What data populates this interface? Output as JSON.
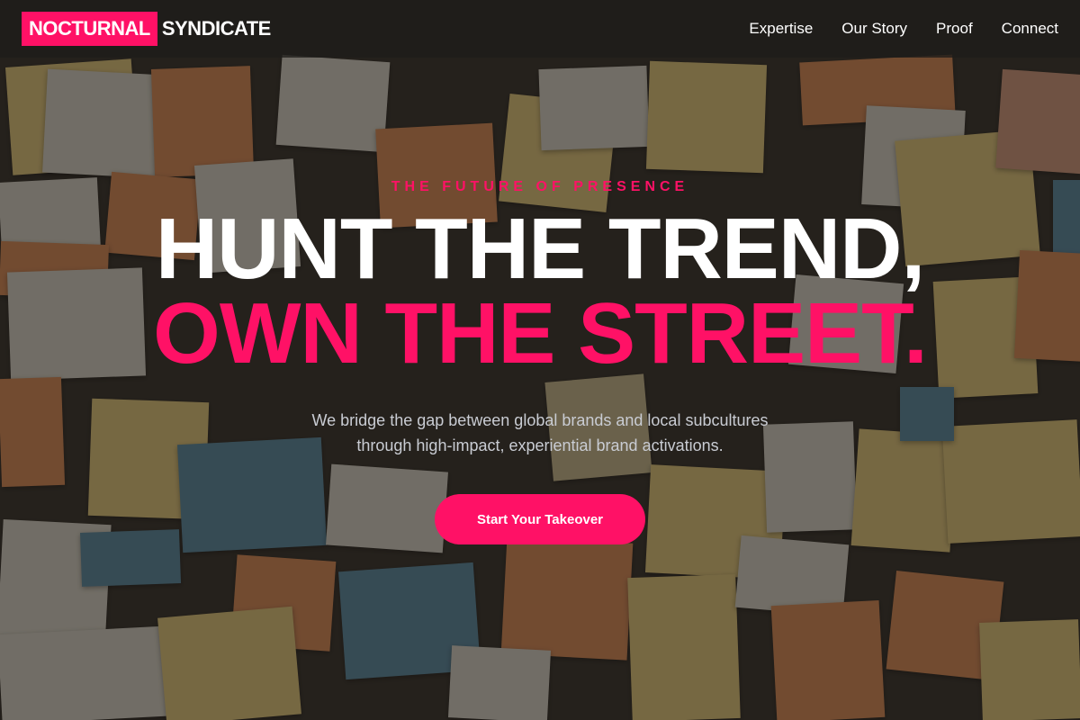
{
  "brand": {
    "name_highlight": "NOCTURNAL",
    "name_rest": "SYNDICATE",
    "accent_color": "#ff1166"
  },
  "nav": {
    "items": [
      {
        "label": "Expertise"
      },
      {
        "label": "Our Story"
      },
      {
        "label": "Proof"
      },
      {
        "label": "Connect"
      }
    ]
  },
  "hero": {
    "eyebrow": "THE FUTURE OF PRESENCE",
    "headline_line1": "HUNT THE TREND,",
    "headline_line2": "OWN THE STREET.",
    "subtitle_line1": "We bridge the gap between global brands and local subcultures",
    "subtitle_line2": "through high-impact, experiential brand activations.",
    "cta_label": "Start Your Takeover"
  },
  "background": {
    "description_icon": "sticky-notes-wall"
  }
}
